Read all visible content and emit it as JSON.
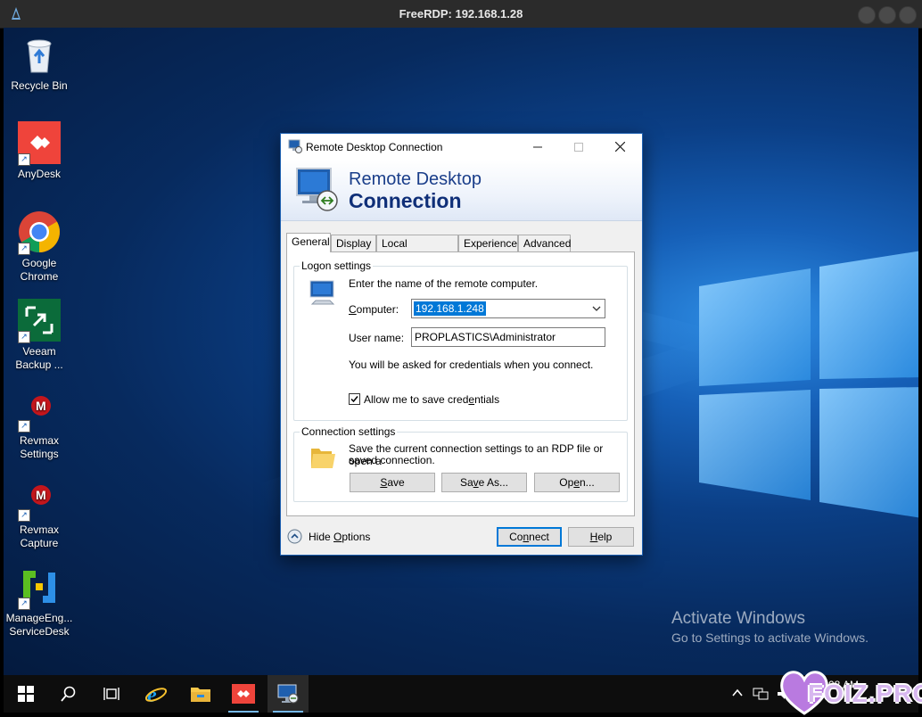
{
  "window": {
    "title": "FreeRDP: 192.168.1.28"
  },
  "desktop": {
    "icons": [
      {
        "label": "Recycle Bin",
        "icon": "recycle-bin-icon"
      },
      {
        "label": "AnyDesk",
        "icon": "anydesk-icon"
      },
      {
        "label": "Google Chrome",
        "icon": "chrome-icon"
      },
      {
        "label": "Veeam Backup ...",
        "icon": "veeam-icon"
      },
      {
        "label": "Revmax Settings",
        "icon": "revmax-icon"
      },
      {
        "label": "Revmax Capture",
        "icon": "revmax-icon"
      },
      {
        "label": "ManageEng... ServiceDesk",
        "icon": "manageengine-icon"
      }
    ],
    "activation": {
      "line1": "Activate Windows",
      "line2": "Go to Settings to activate Windows."
    }
  },
  "dialog": {
    "title": "Remote Desktop Connection",
    "banner_line1": "Remote Desktop",
    "banner_line2": "Connection",
    "tabs": [
      "General",
      "Display",
      "Local Resources",
      "Experience",
      "Advanced"
    ],
    "active_tab": "General",
    "logon": {
      "group_label": "Logon settings",
      "prompt": "Enter the name of the remote computer.",
      "computer_label_pre": "",
      "computer_label_u": "C",
      "computer_label_post": "omputer:",
      "computer_value": "192.168.1.248",
      "username_label": "User name:",
      "username_value": "PROPLASTICS\\Administrator",
      "credentials_note": "You will be asked for credentials when you connect.",
      "save_creds_pre": "Allow me to save cred",
      "save_creds_u": "e",
      "save_creds_post": "ntials",
      "save_creds_checked": true
    },
    "connection": {
      "group_label": "Connection settings",
      "text_line1": "Save the current connection settings to an RDP file or open a",
      "text_line2": "saved connection.",
      "save_pre": "",
      "save_u": "S",
      "save_post": "ave",
      "saveas_pre": "Sa",
      "saveas_u": "v",
      "saveas_post": "e As...",
      "open_pre": "Op",
      "open_u": "e",
      "open_post": "n..."
    },
    "footer": {
      "hide_options_pre": "Hide ",
      "hide_options_u": "O",
      "hide_options_post": "ptions",
      "connect_pre": "Co",
      "connect_u": "n",
      "connect_post": "nect",
      "help_pre": "",
      "help_u": "H",
      "help_post": "elp"
    }
  },
  "taskbar": {
    "items": [
      "start-icon",
      "search-icon",
      "task-view-icon",
      "internet-explorer-icon",
      "file-explorer-icon",
      "anydesk-icon",
      "remote-desktop-icon"
    ],
    "clock": "08 AM",
    "watermark": "FOIZ.PRO"
  },
  "colors": {
    "accent": "#0078d7",
    "banner_text": "#1a3e8a",
    "anydesk": "#ef443b"
  }
}
